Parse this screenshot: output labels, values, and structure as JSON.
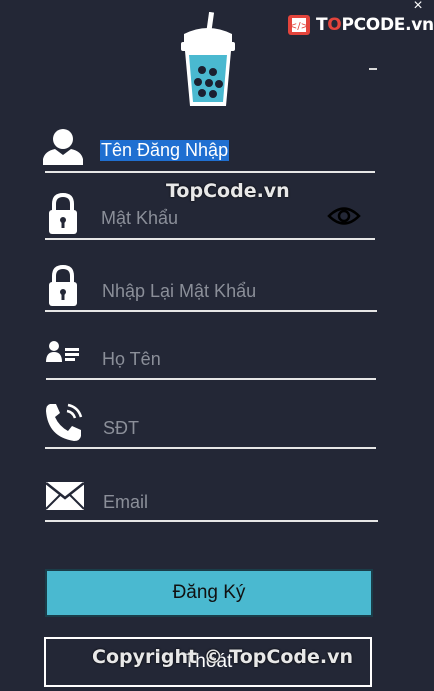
{
  "window": {
    "close_glyph": "×"
  },
  "brand": {
    "text_pre": "T",
    "text_o": "O",
    "text_post": "PCODE.vn",
    "icon": "code-book-logo"
  },
  "watermarks": {
    "center": "TopCode.vn",
    "bottom": "Copyright © TopCode.vn"
  },
  "logo": {
    "icon": "bubble-tea-cup-icon"
  },
  "form": {
    "username": {
      "placeholder": "Tên Đăng Nhập",
      "icon": "user-icon"
    },
    "password": {
      "placeholder": "Mật Khẩu",
      "icon": "lock-icon",
      "toggle_icon": "eye-icon"
    },
    "confirm_password": {
      "placeholder": "Nhập Lại Mật Khẩu",
      "icon": "lock-icon"
    },
    "full_name": {
      "placeholder": "Họ Tên",
      "icon": "id-card-icon"
    },
    "phone": {
      "placeholder": "SĐT",
      "icon": "phone-icon"
    },
    "email": {
      "placeholder": "Email",
      "icon": "envelope-icon"
    }
  },
  "buttons": {
    "register": "Đăng Ký",
    "exit": "Thoát"
  },
  "colors": {
    "background": "#232736",
    "accent": "#4ab9d0",
    "selection": "#1f6fd1",
    "brand_red": "#e3443c"
  }
}
